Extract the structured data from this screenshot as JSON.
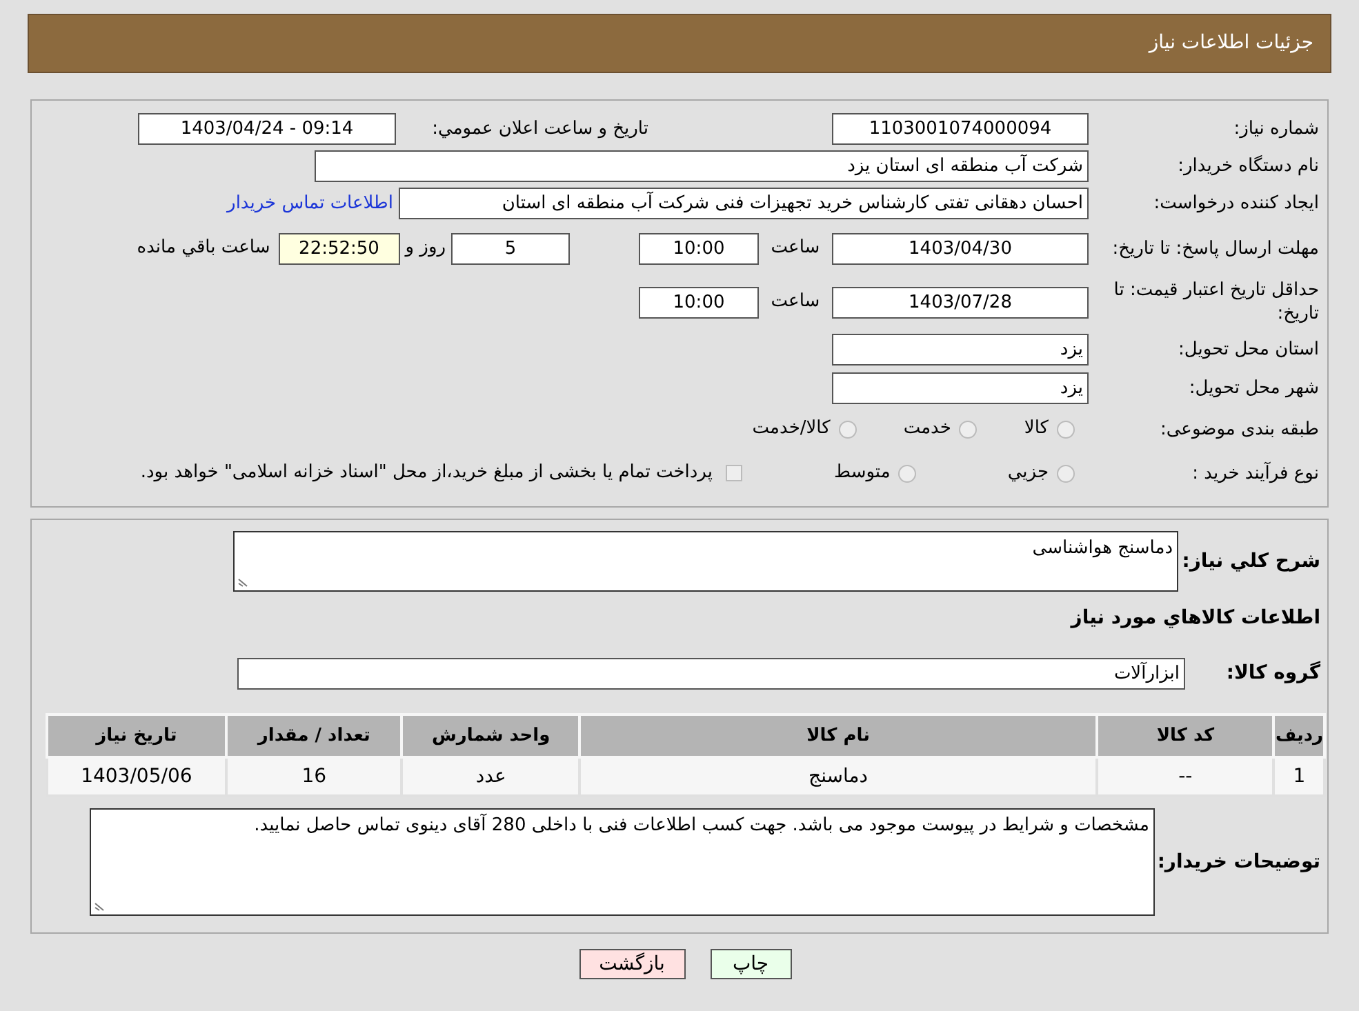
{
  "header": {
    "title": "جزئیات اطلاعات نیاز"
  },
  "need_number": {
    "label": "شماره نیاز:",
    "value": "1103001074000094"
  },
  "announce": {
    "label": "تاريخ و ساعت اعلان عمومي:",
    "value": "1403/04/24 - 09:14"
  },
  "buyer_org": {
    "label": "نام دستگاه خريدار:",
    "value": "شرکت آب منطقه ای استان یزد"
  },
  "creator": {
    "label": "ایجاد کننده درخواست:",
    "value": "احسان دهقانی تفتی کارشناس خرید تجهیزات فنی شرکت آب منطقه ای استان",
    "link": "اطلاعات تماس خريدار"
  },
  "reply_deadline": {
    "label": "مهلت ارسال پاسخ: تا تاریخ:",
    "date": "1403/04/30",
    "time_label": "ساعت",
    "time": "10:00",
    "days": "5",
    "days_label": "روز و",
    "remaining": "22:52:50",
    "remaining_label": "ساعت باقي مانده"
  },
  "price_validity": {
    "label": "حداقل تاریخ اعتبار قیمت: تا تاریخ:",
    "date": "1403/07/28",
    "time_label": "ساعت",
    "time": "10:00"
  },
  "delivery_province": {
    "label": "استان محل تحویل:",
    "value": "یزد"
  },
  "delivery_city": {
    "label": "شهر محل تحویل:",
    "value": "یزد"
  },
  "category": {
    "label": "طبقه بندی موضوعی:",
    "options": [
      {
        "label": "کالا",
        "selected": false
      },
      {
        "label": "خدمت",
        "selected": false
      },
      {
        "label": "کالا/خدمت",
        "selected": false
      }
    ]
  },
  "process": {
    "label": "نوع فرآیند خرید :",
    "options": [
      {
        "kind": "radio",
        "label": "جزيي",
        "selected": false
      },
      {
        "kind": "radio",
        "label": "متوسط",
        "selected": false
      },
      {
        "kind": "checkbox",
        "label": "پرداخت تمام یا بخشی از مبلغ خرید،از محل \"اسناد خزانه اسلامی\" خواهد بود.",
        "checked": false
      }
    ]
  },
  "description": {
    "label": "شرح کلي نياز:",
    "value": "دماسنج هواشناسی"
  },
  "goods_heading": "اطلاعات کالاهاي مورد نياز",
  "goods_group": {
    "label": "گروه کالا:",
    "value": "ابزارآلات"
  },
  "table": {
    "columns": [
      "رديف",
      "کد کالا",
      "نام کالا",
      "واحد شمارش",
      "تعداد / مقدار",
      "تاريخ نياز"
    ],
    "rows": [
      [
        "1",
        "--",
        "دماسنج",
        "عدد",
        "16",
        "1403/05/06"
      ]
    ]
  },
  "buyer_notes": {
    "label": "توضیحات خریدار:",
    "value": "مشخصات و شرایط در پیوست موجود می باشد. جهت کسب اطلاعات فنی با داخلی 280 آقای دینوی تماس حاصل نمایید."
  },
  "buttons": [
    {
      "kind": "print",
      "label": "چاپ"
    },
    {
      "kind": "back",
      "label": "بازگشت"
    }
  ]
}
